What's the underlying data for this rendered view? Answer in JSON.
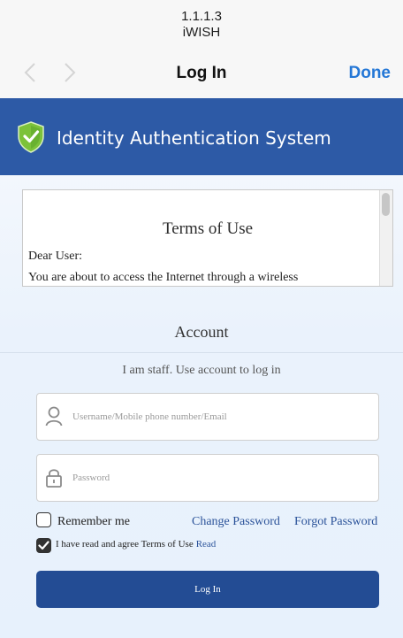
{
  "network": {
    "address": "1.1.1.3",
    "name": "iWISH"
  },
  "nav": {
    "title": "Log In",
    "done_label": "Done",
    "back_icon": "chevron-left-icon",
    "forward_icon": "chevron-right-icon"
  },
  "banner": {
    "title": "Identity Authentication System",
    "icon": "shield-check-icon"
  },
  "terms": {
    "title": "Terms of Use",
    "greeting": "Dear User:",
    "intro": "You are about to access the Internet through a wireless"
  },
  "account": {
    "title": "Account",
    "hint": "I am staff. Use account to log in",
    "username_placeholder": "Username/Mobile phone number/Email",
    "password_placeholder": "Password",
    "remember_label": "Remember me",
    "remember_checked": false,
    "change_password_label": "Change Password",
    "forgot_password_label": "Forgot Password",
    "agree_text": "I have read and agree Terms of Use",
    "agree_checked": true,
    "read_label": "Read",
    "login_label": "Log In"
  },
  "colors": {
    "banner": "#2d5aa6",
    "button": "#234c94",
    "link": "#2a5299",
    "done": "#2477d6",
    "shield": "#7cc23a"
  }
}
